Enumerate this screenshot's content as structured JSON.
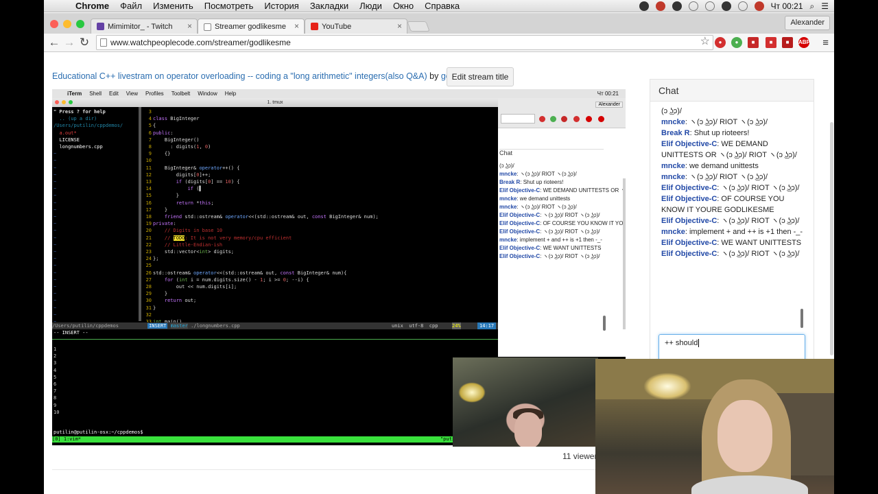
{
  "menubar": {
    "app": "Chrome",
    "items": [
      "Файл",
      "Изменить",
      "Посмотреть",
      "История",
      "Закладки",
      "Люди",
      "Окно",
      "Справка"
    ],
    "clock": "Чт 00:21",
    "user": "Alexander"
  },
  "tabs": [
    {
      "label": "Mimimitor_ - Twitch",
      "color": "#6441a5"
    },
    {
      "label": "Streamer godlikesme",
      "color": "#777777"
    },
    {
      "label": "YouTube",
      "color": "#e62117"
    }
  ],
  "profile": "Alexander",
  "url": "www.watchpeoplecode.com/streamer/godlikesme",
  "stream": {
    "title": "Educational C++ livestram on operator overloading -- coding a \"long arithmetic\" integers(also Q&A)",
    "by": "by",
    "streamer": "godlikesme",
    "edit_label": "Edit stream title",
    "viewers": "11 viewers"
  },
  "video": {
    "inner_menu": [
      "iTerm",
      "Shell",
      "Edit",
      "View",
      "Profiles",
      "Toolbelt",
      "Window",
      "Help"
    ],
    "inner_clock": "Чт 00:21",
    "iterm_title": "1. tmux",
    "tree_help": "\" Press ? for help",
    "tree_path": "/Users/putilin/cppdemos/",
    "tree_files": [
      "a.out*",
      "LICENSE",
      "longnumbers.cpp"
    ],
    "statusline_path": "/Users/putilin/cppdemos",
    "statusline_mode": "INSERT",
    "statusline_branch": "master",
    "statusline_file": "./longnumbers.cpp",
    "statusline_enc": "unix  utf-8  cpp",
    "statusline_pct": "24%",
    "statusline_pos": "14:17",
    "mode_line": "-- INSERT --",
    "prompt": "putilin@putilin-osx:~/cppdemos$",
    "tmux_left": "[0] 1:vim*",
    "tmux_right": "\"putilin-osx.local\"",
    "inner_chat_title": "Chat",
    "inner_user": "Alexander"
  },
  "chat": {
    "title": "Chat",
    "messages": [
      {
        "user": "",
        "text": "(ↄ ͜ʖↄ)/"
      },
      {
        "user": "mncke",
        "text": ": ヽ(ↄ ͜ʖↄ)/ RIOT ヽ(ↄ ͜ʖↄ)/"
      },
      {
        "user": "Break R",
        "text": ": Shut up rioteers!"
      },
      {
        "user": "Elif Objective-C",
        "text": ": WE DEMAND UNITTESTS OR ヽ(ↄ ͜ʖↄ)/ RIOT ヽ(ↄ ͜ʖↄ)/"
      },
      {
        "user": "mncke",
        "text": ": we demand unittests"
      },
      {
        "user": "mncke",
        "text": ": ヽ(ↄ ͜ʖↄ)/ RIOT ヽ(ↄ ͜ʖↄ)/"
      },
      {
        "user": "Elif Objective-C",
        "text": ": ヽ(ↄ ͜ʖↄ)/ RIOT ヽ(ↄ ͜ʖↄ)/"
      },
      {
        "user": "Elif Objective-C",
        "text": ": OF COURSE YOU KNOW IT YOURE GODLIKESME"
      },
      {
        "user": "Elif Objective-C",
        "text": ": ヽ(ↄ ͜ʖↄ)/ RIOT ヽ(ↄ ͜ʖↄ)/"
      },
      {
        "user": "mncke",
        "text": ": implement + and ++ is +1 then -_-"
      },
      {
        "user": "Elif Objective-C",
        "text": ": WE WANT UNITTESTS"
      },
      {
        "user": "Elif Objective-C",
        "text": ": ヽ(ↄ ͜ʖↄ)/ RIOT ヽ(ↄ ͜ʖↄ)/"
      }
    ],
    "input_value": "++ should"
  }
}
